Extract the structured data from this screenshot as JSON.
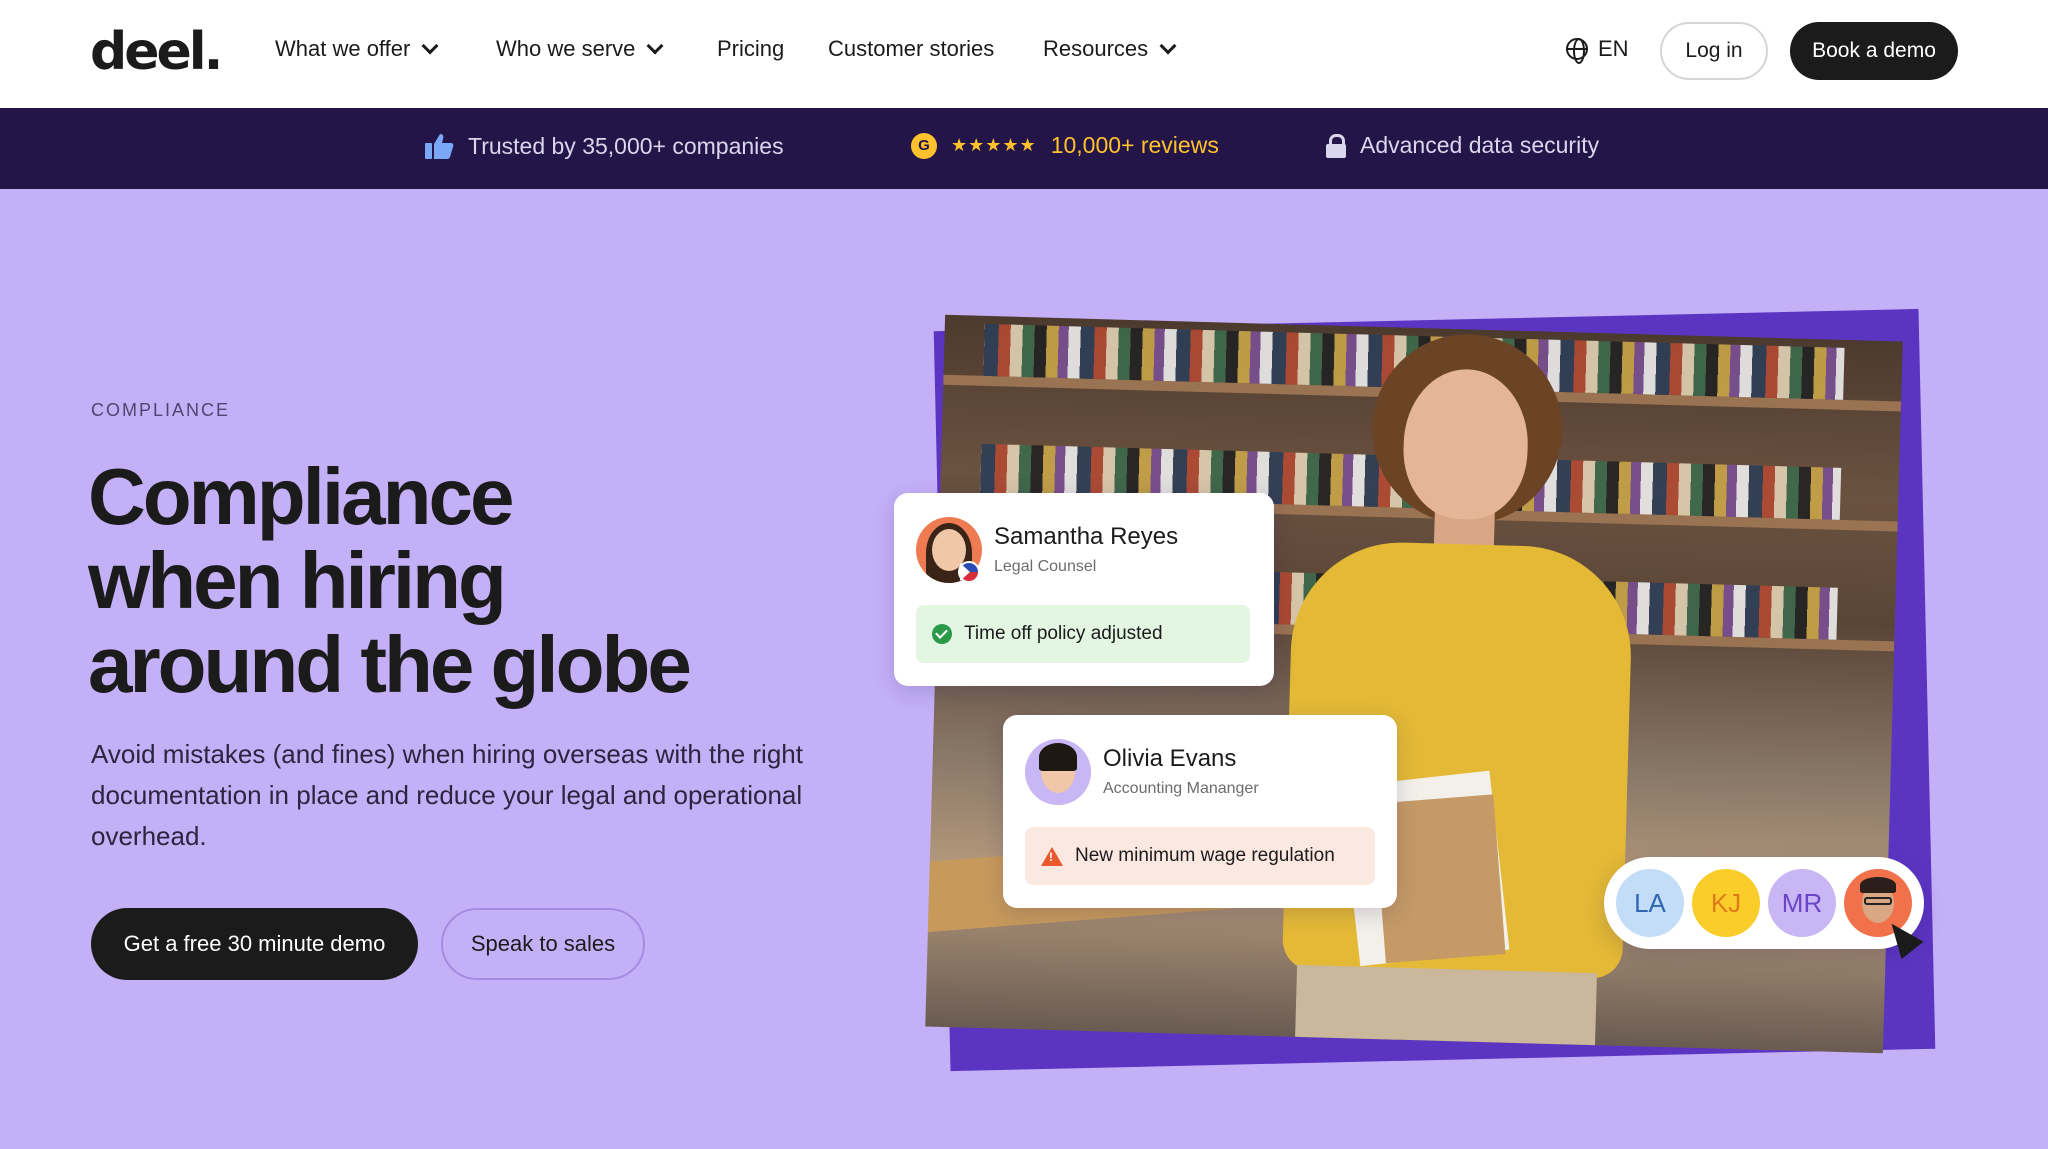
{
  "nav": {
    "logo": "deel.",
    "items": [
      {
        "label": "What we offer",
        "dropdown": true
      },
      {
        "label": "Who we serve",
        "dropdown": true
      },
      {
        "label": "Pricing",
        "dropdown": false
      },
      {
        "label": "Customer stories",
        "dropdown": false
      },
      {
        "label": "Resources",
        "dropdown": true
      }
    ],
    "language": "EN",
    "login_label": "Log in",
    "demo_label": "Book a demo"
  },
  "trust_bar": {
    "companies": "Trusted by 35,000+ companies",
    "g2_badge": "G",
    "stars": "★★★★★",
    "reviews": "10,000+ reviews",
    "security": "Advanced data security"
  },
  "hero": {
    "eyebrow": "COMPLIANCE",
    "headline_line1": "Compliance",
    "headline_line2": "when hiring",
    "headline_line3": "around the globe",
    "subtext": "Avoid mistakes (and fines) when hiring overseas with the right documentation in place and reduce your legal and operational overhead.",
    "primary_cta": "Get a free 30 minute demo",
    "secondary_cta": "Speak to sales"
  },
  "cards": [
    {
      "name": "Samantha Reyes",
      "role": "Legal Counsel",
      "status": "Time off policy adjusted",
      "status_type": "success"
    },
    {
      "name": "Olivia Evans",
      "role": "Accounting Mananger",
      "status": "New minimum wage regulation",
      "status_type": "warning"
    }
  ],
  "avatar_strip": [
    "LA",
    "KJ",
    "MR"
  ],
  "colors": {
    "hero_bg": "#c4b0f7",
    "trust_bg": "#231547",
    "accent_purple": "#5b35c2",
    "star_yellow": "#ffc22e",
    "primary_dark": "#1b1b1b"
  },
  "icons": [
    "chevron-down-icon",
    "globe-icon",
    "thumbs-up-icon",
    "g2-icon",
    "star-icon",
    "lock-icon",
    "check-circle-icon",
    "warning-icon",
    "flag-icon",
    "cursor-icon"
  ]
}
